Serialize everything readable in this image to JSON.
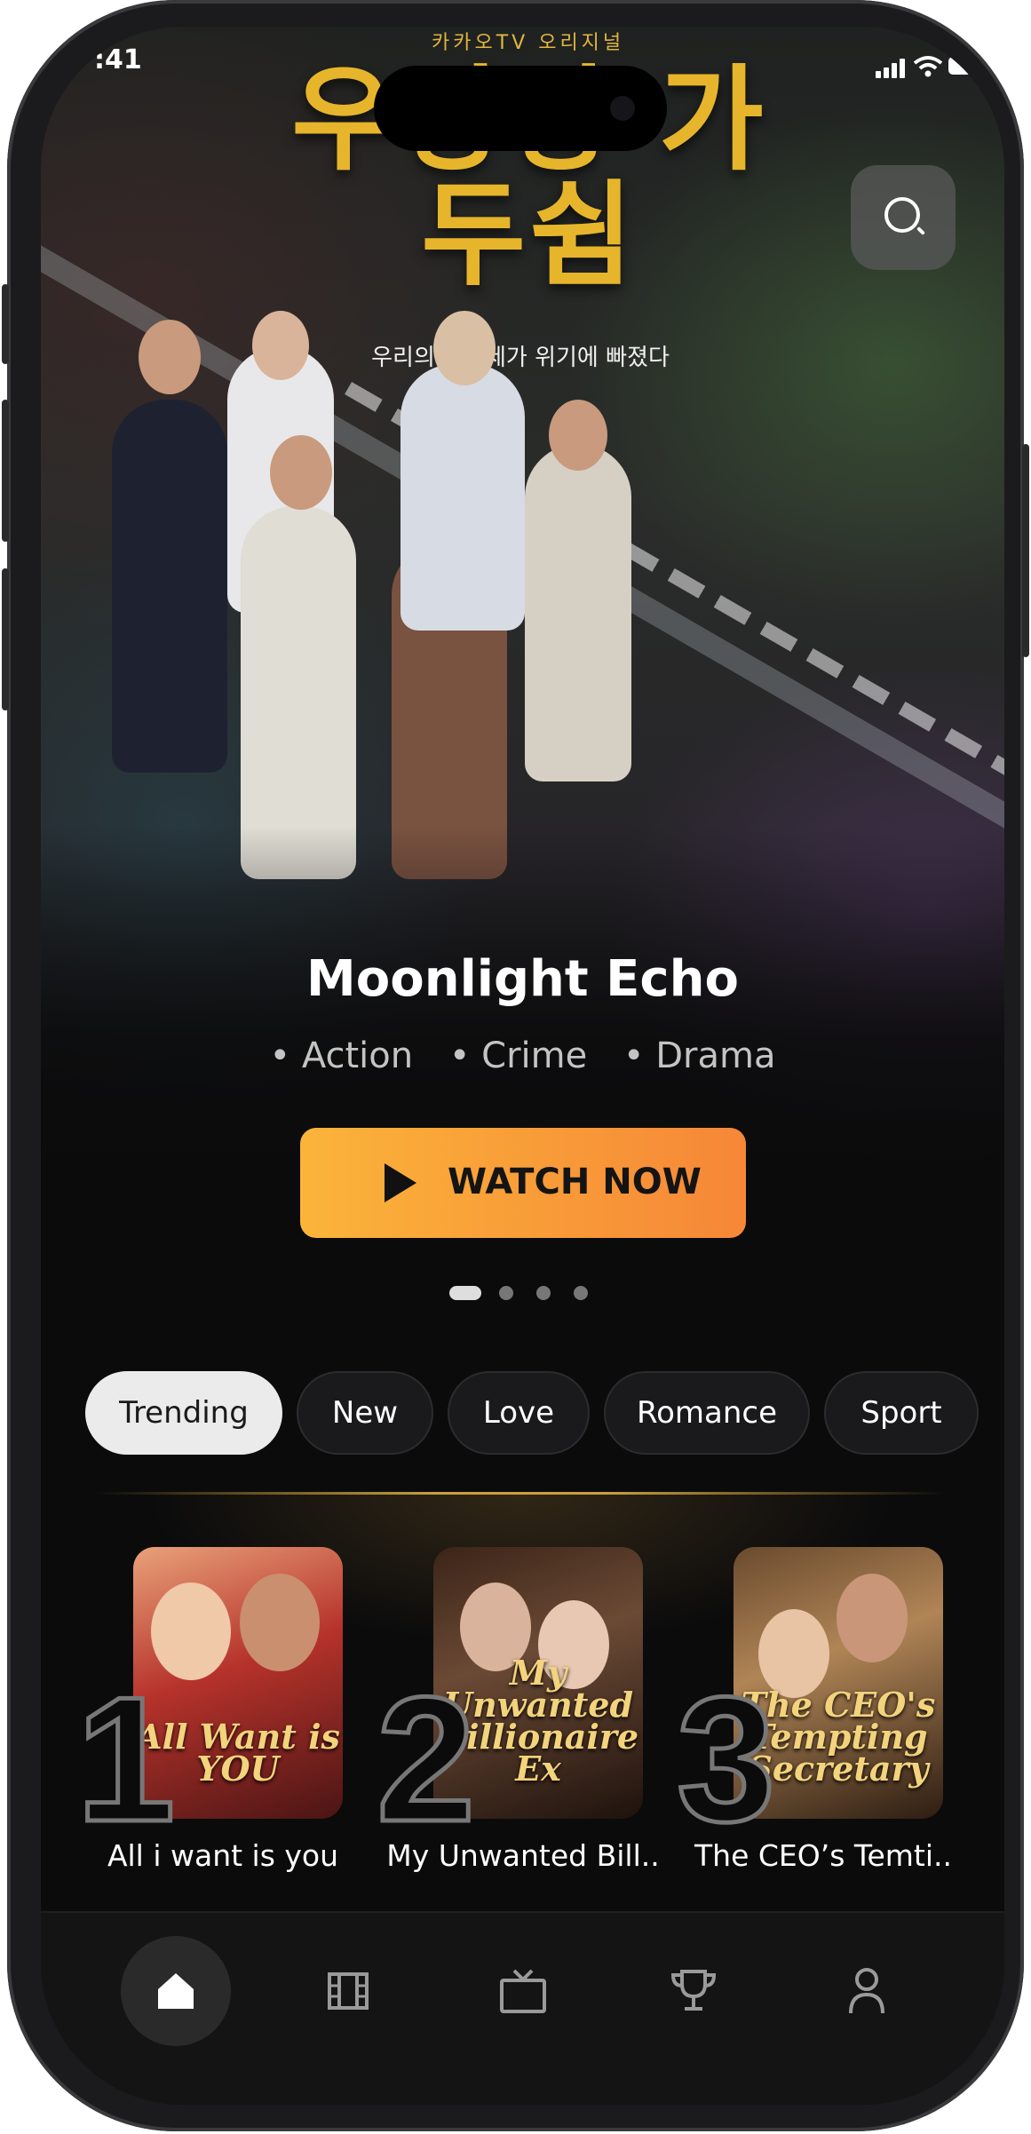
{
  "status_bar": {
    "time": ":41"
  },
  "hero": {
    "poster_top_text": "카카오TV 오리지널",
    "poster_title": "우당탕 가두쉼",
    "poster_tagline": "우리의 십팔세가 위기에 빠졌다",
    "title": "Moonlight Echo",
    "genres": [
      "• Action",
      "• Crime",
      "• Drama"
    ],
    "watch_label": "WATCH NOW",
    "slide_count": 4,
    "active_slide": 1
  },
  "search": {
    "icon": "search-icon"
  },
  "categories": [
    {
      "label": "Trending",
      "active": true
    },
    {
      "label": "New",
      "active": false
    },
    {
      "label": "Love",
      "active": false
    },
    {
      "label": "Romance",
      "active": false
    },
    {
      "label": "Sport",
      "active": false
    }
  ],
  "top_list": [
    {
      "rank": "1",
      "title": "All i want is you",
      "poster_text": "All Want is YOU"
    },
    {
      "rank": "2",
      "title": "My Unwanted Bill..",
      "poster_text": "My Unwanted Billionaire Ex"
    },
    {
      "rank": "3",
      "title": "The CEO’s Temti..",
      "poster_text": "The CEO's Tempting Secretary"
    }
  ],
  "nav": [
    {
      "icon": "home-icon",
      "active": true
    },
    {
      "icon": "film-icon",
      "active": false
    },
    {
      "icon": "tv-icon",
      "active": false
    },
    {
      "icon": "trophy-icon",
      "active": false
    },
    {
      "icon": "profile-icon",
      "active": false
    }
  ],
  "colors": {
    "accent_start": "#fbb43a",
    "accent_end": "#f68737",
    "background": "#0b0b0c"
  }
}
